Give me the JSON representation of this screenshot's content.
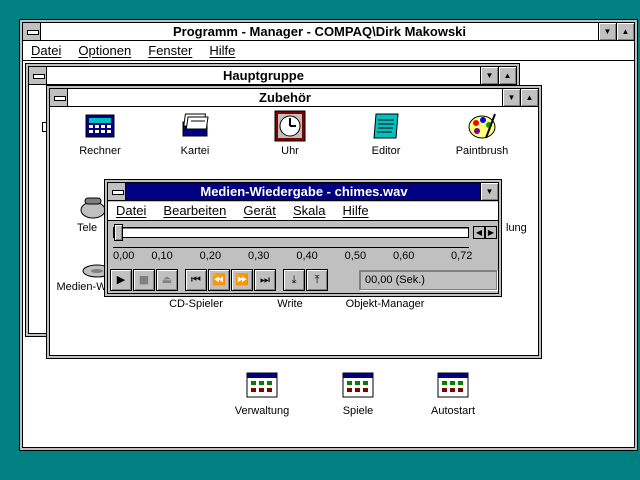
{
  "program_manager": {
    "title": "Programm - Manager - COMPAQ\\Dirk Makowski",
    "menu": [
      "Datei",
      "Optionen",
      "Fenster",
      "Hilfe"
    ],
    "groups": [
      {
        "label": "Verwaltung"
      },
      {
        "label": "Spiele"
      },
      {
        "label": "Autostart"
      }
    ]
  },
  "hauptgruppe": {
    "title": "Hauptgruppe"
  },
  "zubehoer": {
    "title": "Zubehör",
    "icons": [
      {
        "label": "Rechner",
        "icon": "calculator-icon"
      },
      {
        "label": "Kartei",
        "icon": "cardfile-icon"
      },
      {
        "label": "Uhr",
        "icon": "clock-icon"
      },
      {
        "label": "Editor",
        "icon": "notepad-icon"
      },
      {
        "label": "Paintbrush",
        "icon": "paintbrush-icon"
      },
      {
        "label": "Tele",
        "icon": "terminal-icon"
      },
      {
        "label": "lung",
        "icon": "sound-recorder-icon"
      },
      {
        "label": "Medien-Wiedergabe",
        "icon": "media-player-icon"
      },
      {
        "label": "CD-Spieler",
        "icon": "cd-player-icon"
      },
      {
        "label": "Write",
        "icon": "write-icon"
      },
      {
        "label": "Objekt-Manager",
        "icon": "object-packager-icon"
      }
    ]
  },
  "media_player": {
    "title": "Medien-Wiedergabe - chimes.wav",
    "menu": [
      "Datei",
      "Bearbeiten",
      "Gerät",
      "Skala",
      "Hilfe"
    ],
    "scale_ticks": [
      "0,00",
      "0,10",
      "0,20",
      "0,30",
      "0,40",
      "0,50",
      "0,60",
      "0,72"
    ],
    "position_fraction": 0.0,
    "status": "00,00 (Sek.)",
    "controls": [
      {
        "name": "play-button",
        "glyph": "▶"
      },
      {
        "name": "stop-button",
        "glyph": "■"
      },
      {
        "name": "eject-button",
        "glyph": "⏏"
      },
      {
        "name": "prev-mark-button",
        "glyph": "⏮"
      },
      {
        "name": "rewind-button",
        "glyph": "⏪"
      },
      {
        "name": "fast-forward-button",
        "glyph": "⏩"
      },
      {
        "name": "next-mark-button",
        "glyph": "⏭"
      },
      {
        "name": "mark-in-button",
        "glyph": "⤓"
      },
      {
        "name": "mark-out-button",
        "glyph": "⤒"
      }
    ]
  },
  "colors": {
    "desktop": "#008080",
    "active_title": "#000080",
    "button_face": "#c0c0c0"
  }
}
